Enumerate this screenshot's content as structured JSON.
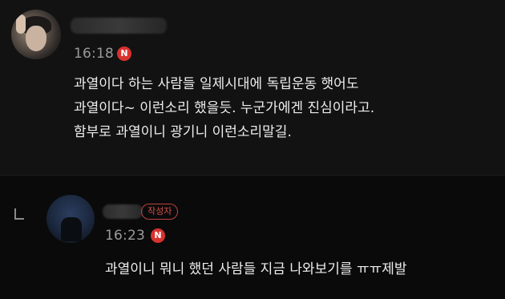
{
  "comments": [
    {
      "time": "16:18",
      "new_badge": "N",
      "lines": [
        "과열이다 하는 사람들 일제시대에 독립운동 햇어도",
        "과열이다~ 이런소리 했을듯. 누군가에겐 진심이라고.",
        "함부로 과열이니 광기니 이런소리말길."
      ]
    },
    {
      "time": "16:23",
      "new_badge": "N",
      "author_badge": "작성자",
      "lines": [
        "과열이니 뭐니 했던 사람들 지금 나와보기를 ㅠㅠ제발"
      ]
    }
  ],
  "colors": {
    "new_badge": "#d8322f",
    "author_badge": "#d4514c",
    "background": "#0b0b0b"
  }
}
